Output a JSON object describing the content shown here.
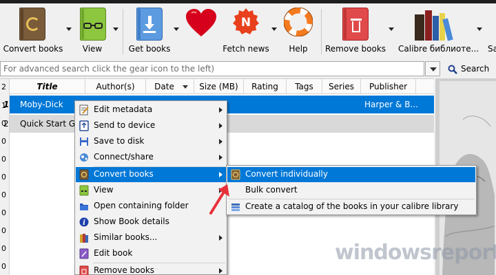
{
  "toolbar": {
    "convert_books": "Convert books",
    "view": "View",
    "get_books": "Get books",
    "fetch_news": "Fetch news",
    "help": "Help",
    "remove_books": "Remove books",
    "calibre_library": "Calibre библиоте...",
    "truncated": "Sa"
  },
  "search": {
    "placeholder": "For advanced search click the gear icon to the left)",
    "button": "Search"
  },
  "table": {
    "headers": {
      "title": "Title",
      "authors": "Author(s)",
      "date": "Date",
      "size": "Size (MB)",
      "rating": "Rating",
      "tags": "Tags",
      "series": "Series",
      "publisher": "Publisher"
    },
    "rows": [
      {
        "num": "1",
        "title": "Moby-Dick",
        "publisher": "Harper & B..."
      },
      {
        "num": "2",
        "title": "Quick Start Gui"
      }
    ],
    "gutter_numbers": [
      "2",
      "1",
      "0",
      "0",
      "0",
      "0",
      "0",
      "0",
      "0",
      "0",
      "0"
    ]
  },
  "context_menu": {
    "items": [
      {
        "label": "Edit metadata"
      },
      {
        "label": "Send to device"
      },
      {
        "label": "Save to disk"
      },
      {
        "label": "Connect/share"
      },
      {
        "label": "Convert books"
      },
      {
        "label": "View"
      },
      {
        "label": "Open containing folder"
      },
      {
        "label": "Show Book details"
      },
      {
        "label": "Similar books..."
      },
      {
        "label": "Edit book"
      },
      {
        "label": "Remove books"
      }
    ]
  },
  "submenu": {
    "items": [
      {
        "label": "Convert individually"
      },
      {
        "label": "Bulk convert"
      },
      {
        "label": "Create a catalog of the books in your calibre library"
      }
    ]
  },
  "watermark": "windowsreport",
  "colors": {
    "selection": "#0078d7",
    "highlight_row": "#d9d9d9",
    "arrow": "#e8303a"
  }
}
